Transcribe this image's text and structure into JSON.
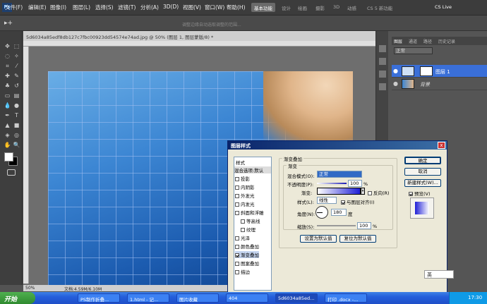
{
  "menu": [
    "文件(F)",
    "编辑(E)",
    "图像(I)",
    "图层(L)",
    "选择(S)",
    "滤镜(T)",
    "分析(A)",
    "3D(D)",
    "视图(V)",
    "窗口(W)",
    "帮助(H)"
  ],
  "zoom": "100%",
  "workspaces": [
    "基本功能",
    "设计",
    "绘画",
    "摄影",
    "3D",
    "动感",
    "CS 5 新功能"
  ],
  "cslive": "CS Live",
  "hint": "调整边缘自动选取调整的范围...",
  "doc_tab": "5d6034a85edf8db127c7fbc00923dd54574e74ad.jpg @ 50% (图层 1, 图层蒙版/8) *",
  "status": {
    "zoom": "50%",
    "doc": "文档:4.59M/6.10M"
  },
  "layers": {
    "tabs": [
      "图层",
      "通道",
      "路径",
      "历史记录"
    ],
    "blend": "正常",
    "rows": [
      {
        "name": "图层 1"
      },
      {
        "name": "背景"
      }
    ]
  },
  "dialog": {
    "title": "图层样式",
    "close": "x",
    "styles_header": "样式",
    "blend_options": "混合选项:默认",
    "styles": [
      {
        "label": "投影",
        "checked": false
      },
      {
        "label": "内阴影",
        "checked": false
      },
      {
        "label": "外发光",
        "checked": false
      },
      {
        "label": "内发光",
        "checked": false
      },
      {
        "label": "斜面和浮雕",
        "checked": false
      },
      {
        "label": "等高线",
        "checked": false
      },
      {
        "label": "纹理",
        "checked": false
      },
      {
        "label": "光泽",
        "checked": false
      },
      {
        "label": "颜色叠加",
        "checked": false
      },
      {
        "label": "渐变叠加",
        "checked": true
      },
      {
        "label": "图案叠加",
        "checked": false
      },
      {
        "label": "描边",
        "checked": false
      }
    ],
    "group_title": "渐变叠加",
    "sub_title": "渐变",
    "blend_label": "混合模式(O):",
    "blend_value": "正常",
    "opacity_label": "不透明度(P):",
    "opacity_value": "100",
    "opacity_unit": "%",
    "gradient_label": "渐变:",
    "reverse_label": "反向(R)",
    "style_label": "样式(L):",
    "style_value": "线性",
    "align_label": "与图层对齐(I)",
    "angle_label": "角度(N):",
    "angle_value": "180",
    "angle_unit": "度",
    "scale_label": "缩放(S):",
    "scale_value": "100",
    "scale_unit": "%",
    "btn_default": "设置为默认值",
    "btn_reset": "复位为默认值",
    "ok": "确定",
    "cancel": "取消",
    "new_style": "新建样式(W)...",
    "preview": "预览(V)"
  },
  "taskbar": {
    "start": "开始",
    "tasks": [
      "PS制作折叠...",
      "1.html - 记...",
      "图片收藏",
      "404",
      "5d6034a85ed...",
      "打印 .docx -..."
    ],
    "time": "17:30",
    "ime": "英"
  },
  "colors": {
    "dialog_bg": "#ece9d8",
    "title_bar": "#0a246a",
    "canvas_blue": "#2f76c9"
  }
}
